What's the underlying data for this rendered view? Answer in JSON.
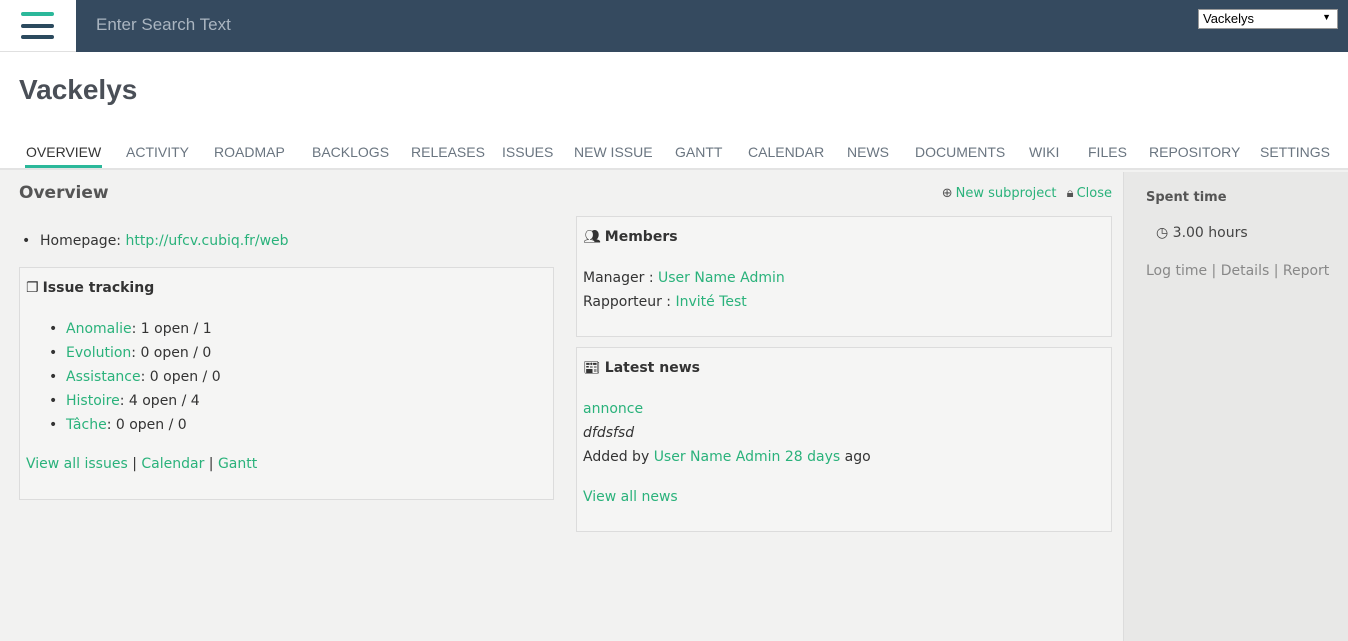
{
  "topbar": {
    "search_placeholder": "Enter Search Text",
    "project_select": "Vackelys"
  },
  "project": {
    "title": "Vackelys"
  },
  "tabs": [
    {
      "label": "OVERVIEW",
      "selected": true
    },
    {
      "label": "ACTIVITY"
    },
    {
      "label": "ROADMAP"
    },
    {
      "label": "BACKLOGS"
    },
    {
      "label": "RELEASES"
    },
    {
      "label": "ISSUES"
    },
    {
      "label": "NEW ISSUE"
    },
    {
      "label": "GANTT"
    },
    {
      "label": "CALENDAR"
    },
    {
      "label": "NEWS"
    },
    {
      "label": "DOCUMENTS"
    },
    {
      "label": "WIKI"
    },
    {
      "label": "FILES"
    },
    {
      "label": "REPOSITORY"
    },
    {
      "label": "SETTINGS"
    }
  ],
  "overview": {
    "heading": "Overview",
    "new_subproject": "New subproject",
    "close": "Close",
    "homepage_label": "Homepage:",
    "homepage_url": "http://ufcv.cubiq.fr/web"
  },
  "issue_tracking": {
    "heading": "Issue tracking",
    "trackers": [
      {
        "name": "Anomalie",
        "counts": ": 1 open / 1"
      },
      {
        "name": "Evolution",
        "counts": ": 0 open / 0"
      },
      {
        "name": "Assistance",
        "counts": ": 0 open / 0"
      },
      {
        "name": "Histoire",
        "counts": ": 4 open / 4"
      },
      {
        "name": "Tâche",
        "counts": ": 0 open / 0"
      }
    ],
    "links": {
      "view_all": "View all issues",
      "calendar": "Calendar",
      "gantt": "Gantt",
      "sep": "|"
    }
  },
  "members": {
    "heading": "Members",
    "manager_label": "Manager :",
    "manager_name": "User Name Admin",
    "reporter_label": "Rapporteur :",
    "reporter_name": "Invité Test"
  },
  "news": {
    "heading": "Latest news",
    "item_title": "annonce",
    "item_desc": "dfdsfsd",
    "added_by": "Added by",
    "author": "User Name Admin",
    "age": "28 days",
    "ago": "ago",
    "view_all": "View all news"
  },
  "sidebar": {
    "title": "Spent time",
    "hours": "3.00 hours",
    "log_time": "Log time",
    "details": "Details",
    "report": "Report",
    "sep": "|"
  },
  "colors": {
    "accent": "#2bb89a",
    "link": "#2ab27b",
    "topbar": "#354a5f"
  }
}
